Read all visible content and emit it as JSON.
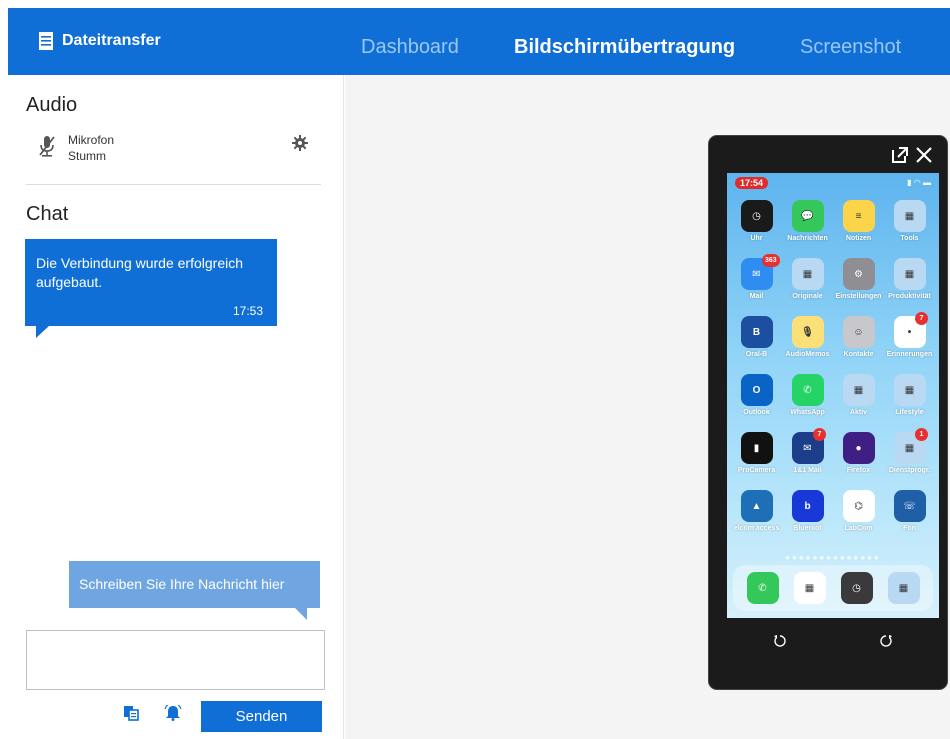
{
  "header": {
    "brand_label": "Dateitransfer",
    "tabs": [
      {
        "label": "Dashboard",
        "active": false
      },
      {
        "label": "Bildschirmübertragung",
        "active": true
      },
      {
        "label": "Screenshot",
        "active": false
      }
    ],
    "accent_color": "#0f6fd6"
  },
  "audio": {
    "heading": "Audio",
    "device_name": "Mikrofon",
    "device_state": "Stumm"
  },
  "chat": {
    "heading": "Chat",
    "messages": [
      {
        "text": "Die Verbindung wurde erfolgreich aufgebaut.",
        "time": "17:53"
      }
    ],
    "hint": "Schreiben Sie Ihre Nachricht hier",
    "input_value": "",
    "send_label": "Senden"
  },
  "phone": {
    "status_time": "17:54",
    "apps": [
      {
        "label": "Uhr",
        "color": "#1a1a1a",
        "glyph": "◷"
      },
      {
        "label": "Nachrichten",
        "color": "#34c759",
        "glyph": "💬"
      },
      {
        "label": "Notizen",
        "color": "#fbd44a",
        "glyph": "≡"
      },
      {
        "label": "Tools",
        "color": "#b9d8f2",
        "glyph": "▦"
      },
      {
        "label": "Mail",
        "color": "#2f8cf0",
        "glyph": "✉",
        "badge": "363"
      },
      {
        "label": "Originale",
        "color": "#b9d8f2",
        "glyph": "▦"
      },
      {
        "label": "Einstellungen",
        "color": "#8e8e93",
        "glyph": "⚙"
      },
      {
        "label": "Produktivität",
        "color": "#b9d8f2",
        "glyph": "▦"
      },
      {
        "label": "Oral-B",
        "color": "#1d4fa0",
        "glyph": "B"
      },
      {
        "label": "AudioMemos",
        "color": "#fbe07a",
        "glyph": "🎙"
      },
      {
        "label": "Kontakte",
        "color": "#c7c7cc",
        "glyph": "☺"
      },
      {
        "label": "Erinnerungen",
        "color": "#ffffff",
        "glyph": "•",
        "badge": "7"
      },
      {
        "label": "Outlook",
        "color": "#0a64c8",
        "glyph": "O"
      },
      {
        "label": "WhatsApp",
        "color": "#25d366",
        "glyph": "✆"
      },
      {
        "label": "Aktiv",
        "color": "#b9d8f2",
        "glyph": "▦"
      },
      {
        "label": "Lifestyle",
        "color": "#b9d8f2",
        "glyph": "▦"
      },
      {
        "label": "ProCamera",
        "color": "#111111",
        "glyph": "▮"
      },
      {
        "label": "1&1 Mail",
        "color": "#1b3d8a",
        "glyph": "✉",
        "badge": "7"
      },
      {
        "label": "Firefox",
        "color": "#3f1f84",
        "glyph": "●"
      },
      {
        "label": "Dienstprogr.",
        "color": "#b9d8f2",
        "glyph": "▦",
        "badge": "1"
      },
      {
        "label": "elcom access",
        "color": "#1f6fb8",
        "glyph": "▲"
      },
      {
        "label": "Blueriiot",
        "color": "#1839d8",
        "glyph": "b"
      },
      {
        "label": "LabCom",
        "color": "#ffffff",
        "glyph": "⌬"
      },
      {
        "label": "Fon",
        "color": "#1f5fa8",
        "glyph": "☏"
      }
    ],
    "dock": [
      {
        "name": "phone-app",
        "color": "#34c759",
        "glyph": "✆"
      },
      {
        "name": "calendar-app",
        "color": "#ffffff",
        "glyph": "▦"
      },
      {
        "name": "clock-app",
        "color": "#3a3a3c",
        "glyph": "◷"
      },
      {
        "name": "folder-app",
        "color": "#b9d8f2",
        "glyph": "▦"
      }
    ]
  }
}
